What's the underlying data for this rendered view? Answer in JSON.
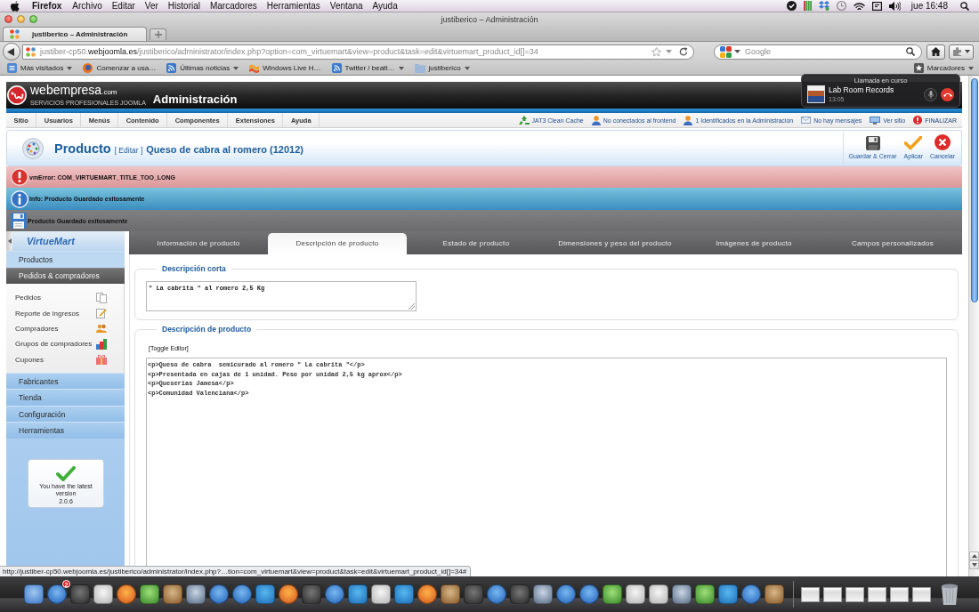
{
  "menu_bar": {
    "app": "Firefox",
    "menus": [
      "Archivo",
      "Editar",
      "Ver",
      "Historial",
      "Marcadores",
      "Herramientas",
      "Ventana",
      "Ayuda"
    ],
    "clock": "jue 16:48"
  },
  "window": {
    "title": "justiberico – Administración"
  },
  "browser_tabs": [
    {
      "label": "justiberico – Administración",
      "selected": true
    }
  ],
  "address_bar": {
    "url_start": "justiber-cp50.",
    "url_domain": "webjoomla.es",
    "url_rest": "/justiberico/administrator/index.php?option=com_virtuemart&view=product&task=edit&virtuemart_product_id[]=34"
  },
  "search_field": {
    "placeholder": "Google"
  },
  "bookmarks": [
    {
      "label": "Más visitados",
      "kind": "smart",
      "menu": true
    },
    {
      "label": "Comenzar a usa…",
      "kind": "browser",
      "menu": false
    },
    {
      "label": "Últimas noticias",
      "kind": "feed",
      "menu": true
    },
    {
      "label": "Windows Live H…",
      "kind": "site",
      "menu": false
    },
    {
      "label": "Twitter / beatt…",
      "kind": "feed",
      "menu": true
    },
    {
      "label": "justiberico",
      "kind": "folder",
      "menu": true
    }
  ],
  "bookmarks_menu": "Marcadores",
  "call_notification": {
    "title": "Llamada en curso",
    "caller": "Lab Room Records",
    "time": "13:05"
  },
  "admin_header": {
    "brand": "webempresa",
    "brand_suffix": ".com",
    "tagline": "SERVICIOS PROFESIONALES JOOMLA",
    "title": "Administración"
  },
  "admin_menu": [
    "Sitio",
    "Usuarios",
    "Menús",
    "Contenido",
    "Componentes",
    "Extensiones",
    "Ayuda"
  ],
  "status_links": [
    {
      "label": "JAT3 Clean Cache",
      "kind": "cache"
    },
    {
      "label": "No conectados al frontend",
      "kind": "users"
    },
    {
      "label": "1 Identificados en la Administración",
      "kind": "users"
    },
    {
      "label": "No hay mensajes",
      "kind": "messages"
    },
    {
      "label": "Ver sitio",
      "kind": "site"
    },
    {
      "label": "FINALIZAR",
      "kind": "logout"
    }
  ],
  "page_title": {
    "section": "Producto",
    "action": "[ Editar ]",
    "item": "Queso de cabra al romero (12012)"
  },
  "toolbar": [
    {
      "label": "Guardar & Cerrar",
      "kind": "save"
    },
    {
      "label": "Aplicar",
      "kind": "apply"
    },
    {
      "label": "Cancelar",
      "kind": "cancel"
    }
  ],
  "messages": [
    {
      "kind": "error",
      "text": "vmError: COM_VIRTUEMART_TITLE_TOO_LONG"
    },
    {
      "kind": "info",
      "text": "Info: Producto Guardado exitosamente"
    },
    {
      "kind": "saved",
      "text": "Producto Guardado exitosamente"
    }
  ],
  "sidebar": {
    "logo": "VirtueMart",
    "sections": [
      {
        "label": "Productos",
        "selected": false
      },
      {
        "label": "Pedidos & compradores",
        "selected": true,
        "children": [
          {
            "label": "Pedidos",
            "kind": "orders"
          },
          {
            "label": "Reporte de ingresos",
            "kind": "report"
          },
          {
            "label": "Compradores",
            "kind": "buyers"
          },
          {
            "label": "Grupos de compradores",
            "kind": "groups"
          },
          {
            "label": "Cupones",
            "kind": "coupons"
          }
        ]
      },
      {
        "label": "Fabricantes",
        "selected": false
      },
      {
        "label": "Tienda",
        "selected": false
      },
      {
        "label": "Configuración",
        "selected": false
      },
      {
        "label": "Herramientas",
        "selected": false
      }
    ],
    "version_card": {
      "text": "You have the latest version",
      "version": "2.0.6"
    }
  },
  "product_tabs": [
    {
      "label": "Información de producto",
      "selected": false
    },
    {
      "label": "Descripción de producto",
      "selected": true
    },
    {
      "label": "Estado de producto",
      "selected": false
    },
    {
      "label": "Dimensiones y peso del producto",
      "selected": false
    },
    {
      "label": "Imágenes de producto",
      "selected": false
    },
    {
      "label": "Campos personalizados",
      "selected": false
    }
  ],
  "short_description": {
    "legend": "Descripción corta",
    "value": "\" La cabrita \" al romero 2,5 Kg"
  },
  "product_description": {
    "legend": "Descripción de producto",
    "toggle": "[Toggle Editor]",
    "lines": [
      "<p>Queso de cabra  semicurado al romero \" La cabrita \"</p>",
      "<p>Presentada en cajas de 1 unidad. Peso por unidad 2,5 kg aprox</p>",
      "<p>Queserias Jamesa</p>",
      "<p>Comunidad Valenciana</p>"
    ]
  },
  "status_url": "http://justiber-cp50.webjoomla.es/justiberico/administrator/index.php?…tion=com_virtuemart&view=product&task=edit&virtuemart_product_id[]=34#",
  "dock": {
    "badge": "2"
  }
}
